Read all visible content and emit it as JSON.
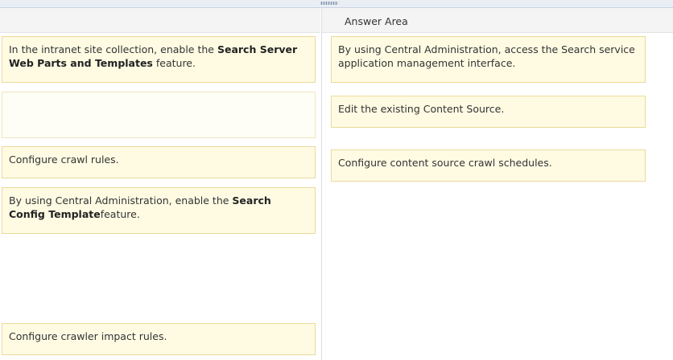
{
  "answer_area": {
    "title": "Answer Area"
  },
  "source_items": [
    {
      "pre": "In the intranet site collection, enable the ",
      "bold": "Search Server Web Parts and Templates",
      "post": " feature."
    },
    {
      "pre": "",
      "bold": "",
      "post": ""
    },
    {
      "pre": "Configure crawl rules.",
      "bold": "",
      "post": ""
    },
    {
      "pre": "By using Central Administration, enable the ",
      "bold": "Search Config Template",
      "post": "feature."
    },
    {
      "pre": "Configure crawler impact rules.",
      "bold": "",
      "post": ""
    }
  ],
  "answer_items": [
    {
      "text": "By using Central Administration, access the Search service application management interface."
    },
    {
      "text": "Edit the existing Content Source."
    },
    {
      "text": "Configure content source crawl schedules."
    }
  ]
}
